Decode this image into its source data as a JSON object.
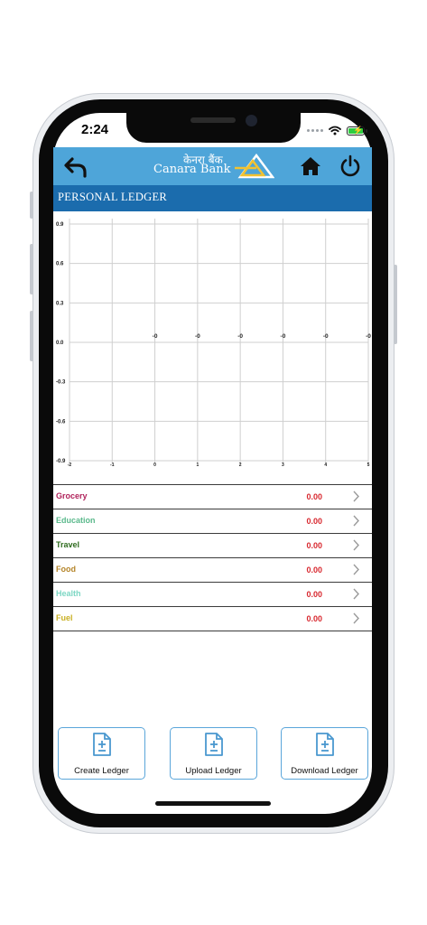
{
  "status_bar": {
    "time": "2:24"
  },
  "header": {
    "logo_hindi": "केनरा बैंक",
    "logo_english": "Canara Bank",
    "icons": [
      "back-arrow-icon",
      "home-icon",
      "power-icon"
    ]
  },
  "page": {
    "title": "PERSONAL LEDGER"
  },
  "chart_data": {
    "type": "bar",
    "x_ticks": [
      "-2",
      "-1",
      "0",
      "1",
      "2",
      "3",
      "4",
      "5"
    ],
    "y_ticks": [
      "0.9",
      "0.6",
      "0.3",
      "0.0",
      "-0.3",
      "-0.6",
      "-0.9"
    ],
    "xlim": [
      -2,
      5
    ],
    "ylim": [
      -0.9,
      0.9
    ],
    "data_labels": [
      {
        "x": 0,
        "y": 0,
        "label": "-0"
      },
      {
        "x": 1,
        "y": 0,
        "label": "-0"
      },
      {
        "x": 2,
        "y": 0,
        "label": "-0"
      },
      {
        "x": 3,
        "y": 0,
        "label": "-0"
      },
      {
        "x": 4,
        "y": 0,
        "label": "-0"
      },
      {
        "x": 5,
        "y": 0,
        "label": "-0"
      }
    ],
    "grid": true
  },
  "ledger": {
    "items": [
      {
        "label": "Grocery",
        "value": "0.00",
        "color": "#b0235b"
      },
      {
        "label": "Education",
        "value": "0.00",
        "color": "#5bb98c"
      },
      {
        "label": "Travel",
        "value": "0.00",
        "color": "#2e6b1e"
      },
      {
        "label": "Food",
        "value": "0.00",
        "color": "#b5852a"
      },
      {
        "label": "Health",
        "value": "0.00",
        "color": "#7dd7c4"
      },
      {
        "label": "Fuel",
        "value": "0.00",
        "color": "#c9b024"
      }
    ]
  },
  "actions": {
    "create_label": "Create Ledger",
    "upload_label": "Upload Ledger",
    "download_label": "Download Ledger"
  },
  "colors": {
    "app_bar": "#4ea5d9",
    "section_bar": "#1b6cad",
    "value_red": "#d8282f",
    "button_border": "#5aa6da"
  }
}
